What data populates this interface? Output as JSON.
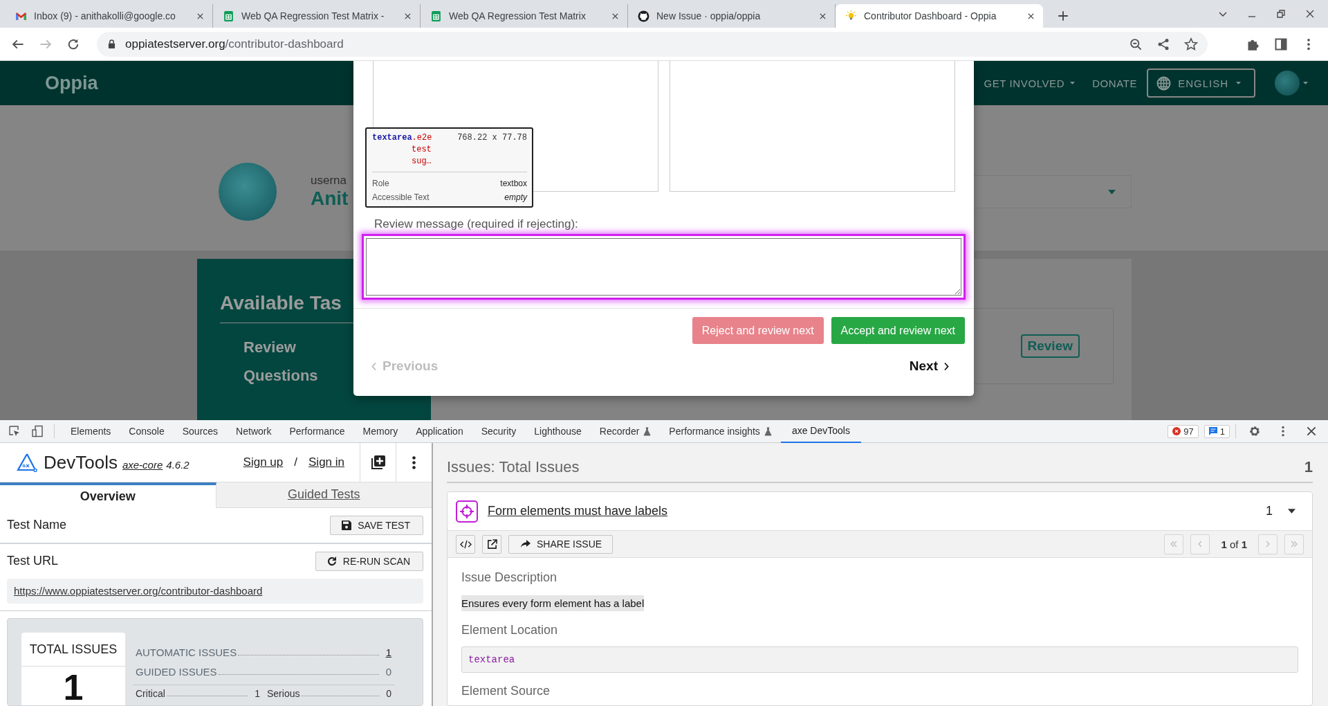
{
  "browser": {
    "tabs": [
      {
        "kind": "mail",
        "title": "Inbox (9) - anithakolli@google.co",
        "selected": false
      },
      {
        "kind": "sheet",
        "title": "Web QA Regression Test Matrix -",
        "selected": false
      },
      {
        "kind": "sheet",
        "title": "Web QA Regression Test Matrix",
        "selected": false
      },
      {
        "kind": "repo",
        "title": "New Issue · oppia/oppia",
        "selected": false
      },
      {
        "kind": "bulb",
        "title": "Contributor Dashboard - Oppia",
        "selected": true
      }
    ],
    "url_host": "oppiatestserver.org",
    "url_path": "/contributor-dashboard"
  },
  "site": {
    "logo": "Oppia",
    "nav": [
      {
        "label": "GET INVOLVED",
        "dropdown": true
      },
      {
        "label": "DONATE",
        "dropdown": false
      }
    ],
    "language": "ENGLISH",
    "profile": {
      "label": "userna",
      "name": "Anit"
    },
    "tasks": {
      "title": "Available Tas",
      "item": "Review Questions"
    },
    "review_button": "Review"
  },
  "modal": {
    "label": "Review message (required if rejecting):",
    "actions": [
      {
        "kind": "reject",
        "label": "Reject and review next"
      },
      {
        "kind": "accept",
        "label": "Accept and review next"
      }
    ],
    "previous": {
      "label": "Previous",
      "disabled": true
    },
    "next": {
      "label": "Next",
      "disabled": false
    }
  },
  "inspector": {
    "tag": "textarea",
    "class_lines": [
      ".e2e",
      "test",
      "sug…"
    ],
    "size": "768.22 x 77.78",
    "rows": [
      {
        "label": "Role",
        "value": "textbox",
        "kind": "plain"
      },
      {
        "label": "Accessible Text",
        "value": "empty",
        "kind": "italic"
      }
    ]
  },
  "devtools": {
    "tabs": [
      {
        "label": "Elements",
        "experimental": false,
        "selected": false
      },
      {
        "label": "Console",
        "experimental": false,
        "selected": false
      },
      {
        "label": "Sources",
        "experimental": false,
        "selected": false
      },
      {
        "label": "Network",
        "experimental": false,
        "selected": false
      },
      {
        "label": "Performance",
        "experimental": false,
        "selected": false
      },
      {
        "label": "Memory",
        "experimental": false,
        "selected": false
      },
      {
        "label": "Application",
        "experimental": false,
        "selected": false
      },
      {
        "label": "Security",
        "experimental": false,
        "selected": false
      },
      {
        "label": "Lighthouse",
        "experimental": false,
        "selected": false
      },
      {
        "label": "Recorder",
        "experimental": true,
        "selected": false
      },
      {
        "label": "Performance insights",
        "experimental": true,
        "selected": false
      },
      {
        "label": "axe DevTools",
        "experimental": false,
        "selected": true
      }
    ],
    "errors": "97",
    "messages": "1"
  },
  "axe": {
    "product": "DevTools",
    "core": "axe-core",
    "version": "4.6.2",
    "sign_up": "Sign up",
    "separator": "/",
    "sign_in": "Sign in",
    "tabs": [
      {
        "label": "Overview",
        "selected": true
      },
      {
        "label": "Guided Tests",
        "selected": false
      }
    ],
    "test_name_label": "Test Name",
    "save_button": "SAVE TEST",
    "test_url_label": "Test URL",
    "rerun_button": "RE-RUN SCAN",
    "test_url": "https://www.oppiatestserver.org/contributor-dashboard",
    "summary": {
      "title": "TOTAL ISSUES",
      "total": "1",
      "rows": [
        {
          "label": "AUTOMATIC ISSUES",
          "value": "1",
          "link": true
        },
        {
          "label": "GUIDED ISSUES",
          "value": "0",
          "link": false
        }
      ],
      "impacts": [
        {
          "label": "Critical",
          "value": "1"
        },
        {
          "label": "Serious",
          "value": "0"
        }
      ]
    },
    "issues": {
      "heading": "Issues: Total Issues",
      "count": "1",
      "issue": {
        "title": "Form elements must have labels",
        "count": "1",
        "expanded": true,
        "share": "SHARE ISSUE",
        "pager": "**1** of **1**",
        "description_label": "Issue Description",
        "description": "Ensures every form element has a label",
        "location_label": "Element Location",
        "location": "textarea",
        "source_label": "Element Source"
      }
    }
  }
}
